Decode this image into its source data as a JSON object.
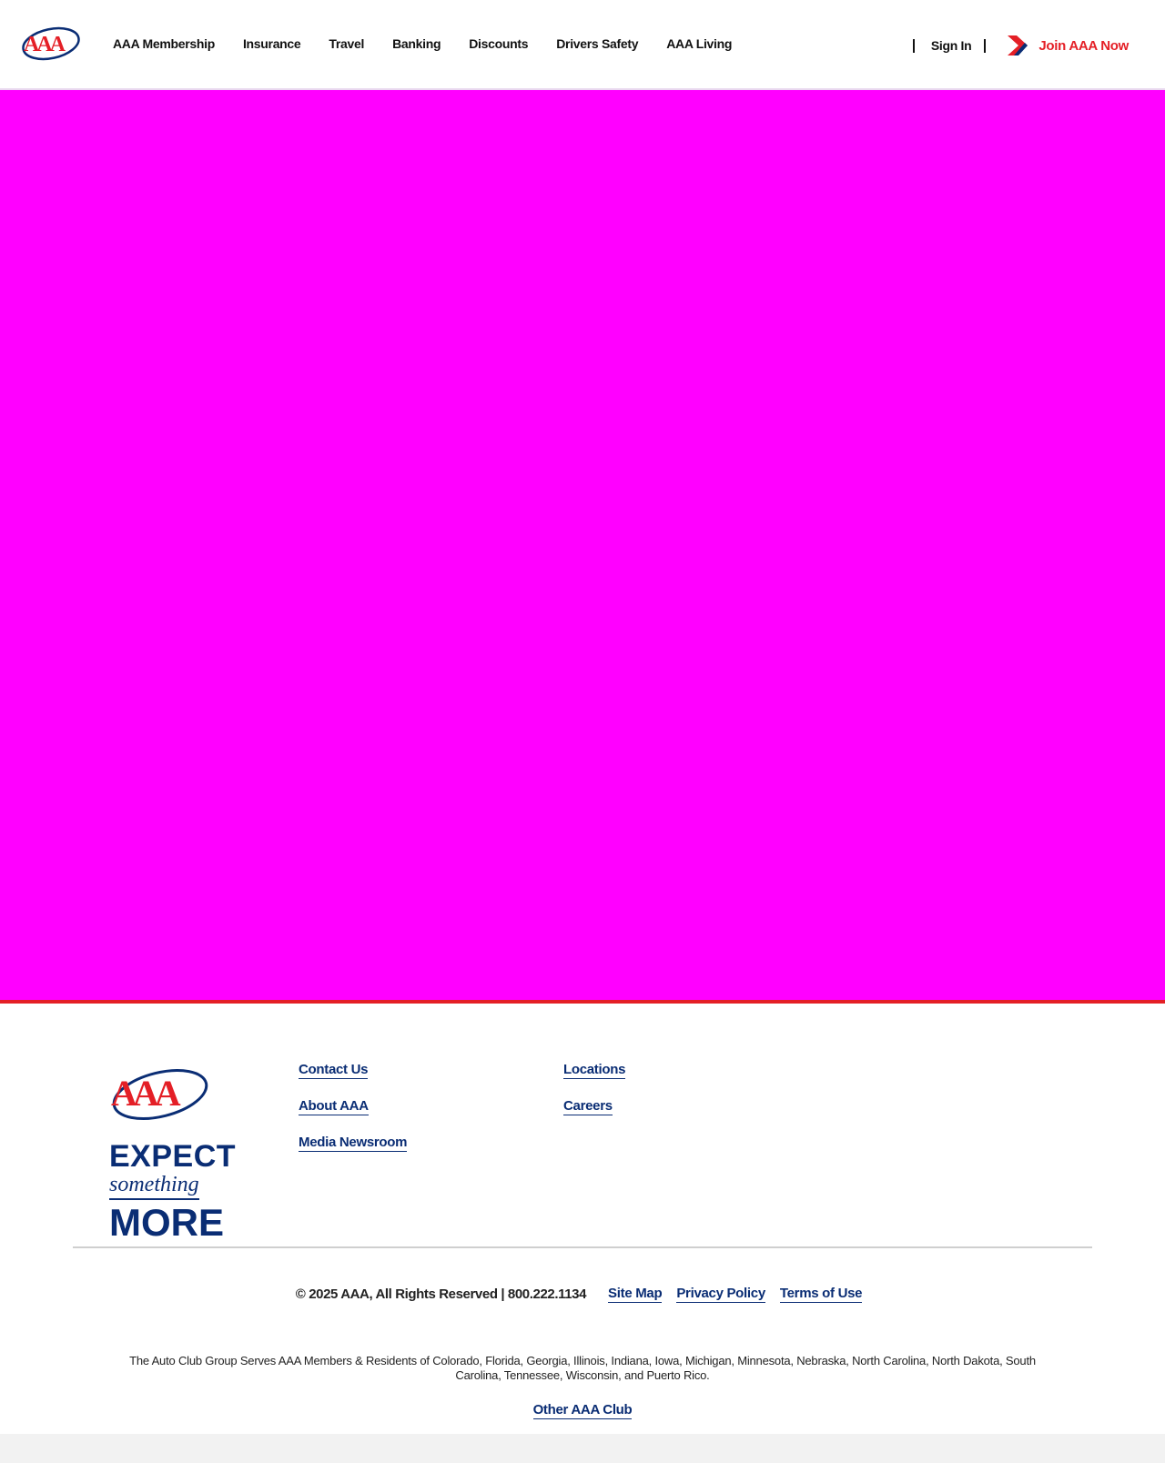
{
  "brand": {
    "logo_text": "AAA",
    "primary_red": "#e41f26",
    "primary_blue": "#0a2d74",
    "hero_color": "#ff00ff"
  },
  "header": {
    "nav": [
      {
        "label": "AAA Membership"
      },
      {
        "label": "Insurance"
      },
      {
        "label": "Travel"
      },
      {
        "label": "Banking"
      },
      {
        "label": "Discounts"
      },
      {
        "label": "Drivers Safety"
      },
      {
        "label": "AAA Living"
      }
    ],
    "sign_in": "Sign In",
    "join": "Join AAA Now"
  },
  "footer": {
    "tagline": {
      "expect": "EXPECT",
      "something": "something",
      "more": "MORE"
    },
    "links_col1": [
      "Contact Us",
      "About AAA",
      "Media Newsroom"
    ],
    "links_col2": [
      "Locations",
      "Careers"
    ],
    "copyright": "© 2025 AAA, All Rights Reserved | 800.222.1134",
    "legal_links": [
      "Site Map",
      "Privacy Policy",
      "Terms of Use"
    ],
    "serves": "The Auto Club Group Serves AAA Members & Residents of Colorado, Florida, Georgia, Illinois, Indiana, Iowa, Michigan, Minnesota, Nebraska, North Carolina, North Dakota, South Carolina, Tennessee, Wisconsin, and Puerto Rico.",
    "other_club": "Other AAA Club"
  }
}
